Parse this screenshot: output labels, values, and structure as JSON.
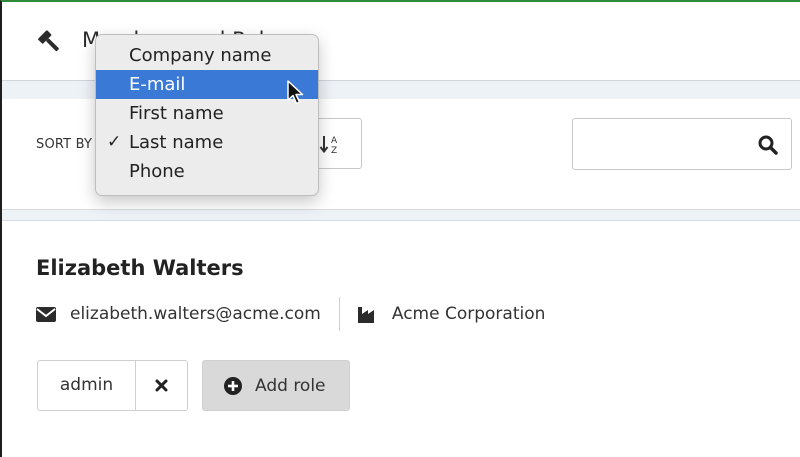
{
  "header": {
    "title": "Members and Roles",
    "icon": "gavel-icon"
  },
  "toolbar": {
    "sort_label": "SORT BY",
    "sort_direction_icon": "sort-alpha-down-icon",
    "search": {
      "value": "",
      "placeholder": "",
      "button_icon": "search-icon"
    }
  },
  "sort_menu": {
    "options": [
      {
        "label": "Company name",
        "checked": false,
        "highlighted": false
      },
      {
        "label": "E-mail",
        "checked": false,
        "highlighted": true
      },
      {
        "label": "First name",
        "checked": false,
        "highlighted": false
      },
      {
        "label": "Last name",
        "checked": true,
        "highlighted": false
      },
      {
        "label": "Phone",
        "checked": false,
        "highlighted": false
      }
    ],
    "check_mark": "✓",
    "highlight_color": "#3a79d6"
  },
  "member": {
    "name": "Elizabeth Walters",
    "email": "elizabeth.walters@acme.com",
    "company": "Acme Corporation",
    "roles": [
      {
        "label": "admin"
      }
    ],
    "add_role_label": "Add role"
  },
  "colors": {
    "band": "#edf2f7",
    "add_role_bg": "#d9d9d9",
    "frame_top": "#2f8a3a"
  }
}
